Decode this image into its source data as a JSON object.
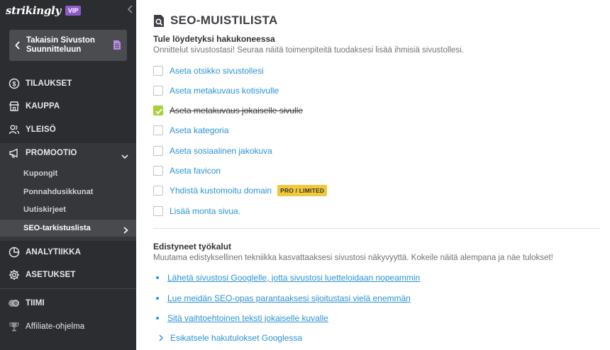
{
  "brand": {
    "logo": "strikingly",
    "badge": "VIP"
  },
  "sidebar": {
    "back_button": {
      "label": "Takaisin Sivuston Suunnitteluun"
    },
    "items": [
      {
        "label": "TILAUKSET",
        "icon": "dollar-circle-icon"
      },
      {
        "label": "KAUPPA",
        "icon": "store-icon"
      },
      {
        "label": "YLEISÖ",
        "icon": "users-icon"
      },
      {
        "label": "PROMOOTIO",
        "icon": "megaphone-icon",
        "expanded": true
      },
      {
        "label": "ANALYTIIKKA",
        "icon": "pie-chart-icon"
      },
      {
        "label": "ASETUKSET",
        "icon": "gear-icon"
      },
      {
        "label": "TIIMI",
        "icon": "team-icon"
      },
      {
        "label": "Affiliate-ohjelma",
        "icon": "trophy-icon"
      }
    ],
    "promo_subitems": [
      {
        "label": "Kupongit"
      },
      {
        "label": "Ponnahdusikkunat"
      },
      {
        "label": "Uutiskirjeet"
      },
      {
        "label": "SEO-tarkistuslista",
        "active": true
      }
    ]
  },
  "main": {
    "title": "SEO-MUISTILISTA",
    "section1": {
      "heading": "Tule löydetyksi hakukoneessa",
      "subtitle": "Onnittelut sivustostasi! Seuraa näitä toimenpiteitä tuodaksesi lisää ihmisiä sivustollesi."
    },
    "checklist": [
      {
        "label": "Aseta otsikko sivustollesi",
        "checked": false
      },
      {
        "label": "Aseta metakuvaus kotisivulle",
        "checked": false
      },
      {
        "label": "Aseta metakuvaus jokaiselle sivulle",
        "checked": true
      },
      {
        "label": "Aseta kategoria",
        "checked": false
      },
      {
        "label": "Aseta sosiaalinen jakokuva",
        "checked": false
      },
      {
        "label": "Aseta favicon",
        "checked": false
      },
      {
        "label": "Yhdistä kustomoitu domain",
        "checked": false,
        "badge": "PRO / LIMITED"
      },
      {
        "label": "Lisää monta sivua.",
        "checked": false
      }
    ],
    "section2": {
      "heading": "Edistyneet työkalut",
      "subtitle": "Muutama edistyksellinen tekniikka kasvattaaksesi sivustosi näkyvyyttä. Kokeile näitä alempana ja näe tulokset!"
    },
    "links": [
      {
        "label": "Lähetä sivustosi Googlelle, jotta sivustosi luetteloidaan nopeammin"
      },
      {
        "label": "Lue meidän SEO-opas parantaaksesi sijoitustasi vielä enemmän"
      },
      {
        "label": "Sitä vaihtoehtoinen teksti jokaiselle kuvalle"
      },
      {
        "label": "Esikatsele hakutulokset Googlessa"
      }
    ]
  },
  "colors": {
    "sidebar": "#2b2d30",
    "link": "#2a93d5",
    "check": "#a6d13a",
    "badge": "#f0c93a",
    "vip": "#8e5ac9"
  }
}
